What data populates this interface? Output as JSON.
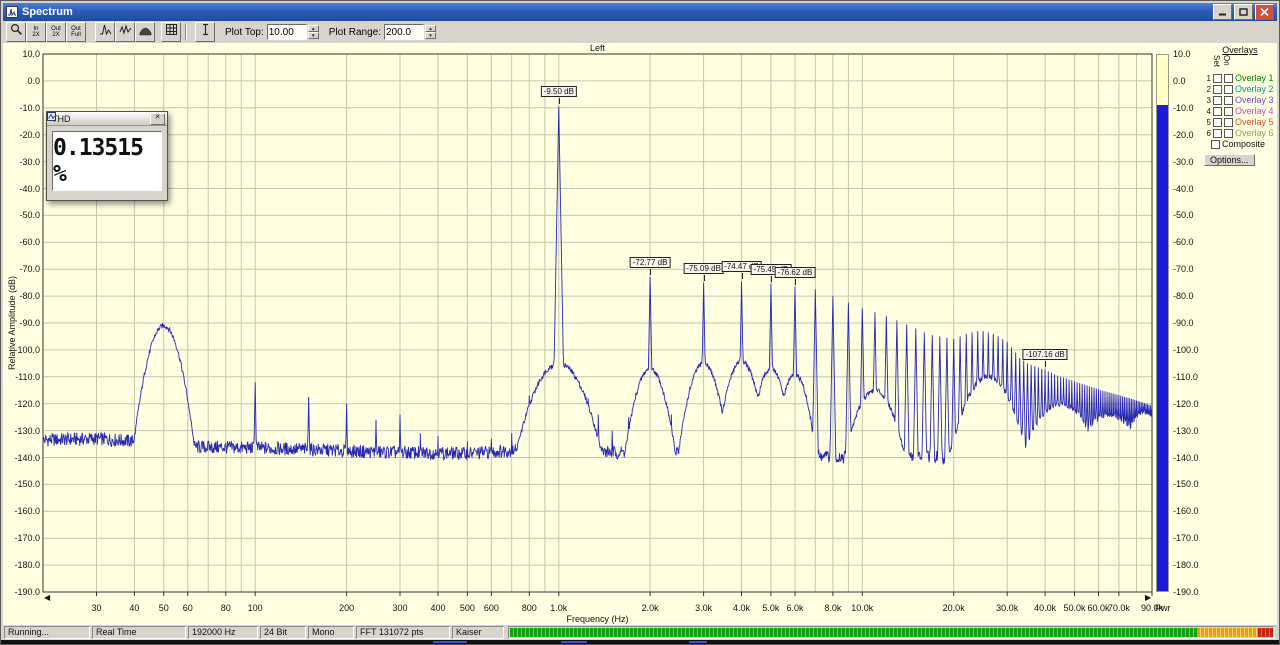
{
  "window": {
    "title": "Spectrum",
    "controls": [
      "minimize",
      "maximize",
      "close"
    ]
  },
  "toolbar": {
    "buttons": [
      {
        "name": "zoom-select-button",
        "icon": "magnifier"
      },
      {
        "name": "zoom-in-2x-button",
        "lines": [
          "In",
          "2X"
        ]
      },
      {
        "name": "zoom-out-2x-button",
        "lines": [
          "Out",
          "2X"
        ]
      },
      {
        "name": "zoom-out-full-button",
        "lines": [
          "Out",
          "Full"
        ]
      },
      {
        "name": "peak-hold-button",
        "icon": "peak-curve"
      },
      {
        "name": "line-plot-button",
        "icon": "line-curve"
      },
      {
        "name": "filled-plot-button",
        "icon": "filled-curve"
      },
      {
        "name": "data-table-button",
        "icon": "grid"
      },
      {
        "name": "marker-tool-button",
        "icon": "ibeam"
      }
    ],
    "plot_top_label": "Plot Top:",
    "plot_top_value": "10.00",
    "plot_range_label": "Plot Range:",
    "plot_range_value": "200.0"
  },
  "thd_window": {
    "title": "THD",
    "value": "0.13515 %"
  },
  "overlays": {
    "header": "Overlays",
    "col_set": "Set",
    "col_on": "On",
    "rows": [
      {
        "num": "1",
        "label": "Overlay 1",
        "color": "#008800"
      },
      {
        "num": "2",
        "label": "Overlay 2",
        "color": "#009999"
      },
      {
        "num": "3",
        "label": "Overlay 3",
        "color": "#7744cc"
      },
      {
        "num": "4",
        "label": "Overlay 4",
        "color": "#cc44cc"
      },
      {
        "num": "5",
        "label": "Overlay 5",
        "color": "#dd5522"
      },
      {
        "num": "6",
        "label": "Overlay 6",
        "color": "#aa9944"
      }
    ],
    "composite_label": "Composite",
    "options_button": "Options..."
  },
  "statusbar": {
    "items": [
      "Running...",
      "Real Time",
      "192000 Hz",
      "24 Bit",
      "Mono",
      "FFT 131072 pts",
      "Kaiser"
    ],
    "meter": {
      "green_pct": 90,
      "amber_pct": 8,
      "red_pct": 2
    }
  },
  "chart_data": {
    "type": "line",
    "title": "Left",
    "xlabel": "Frequency (Hz)",
    "ylabel": "Relative Amplitude (dB)",
    "xscale": "log",
    "xlim": [
      20,
      90000
    ],
    "ylim": [
      -190,
      10
    ],
    "ytick_step": 10,
    "grid": true,
    "trace_color": "#2828b4",
    "background_color": "#ffffe1",
    "x_ticks": [
      {
        "f": 30,
        "l": "30"
      },
      {
        "f": 40,
        "l": "40"
      },
      {
        "f": 50,
        "l": "50"
      },
      {
        "f": 60,
        "l": "60"
      },
      {
        "f": 80,
        "l": "80"
      },
      {
        "f": 100,
        "l": "100"
      },
      {
        "f": 200,
        "l": "200"
      },
      {
        "f": 300,
        "l": "300"
      },
      {
        "f": 400,
        "l": "400"
      },
      {
        "f": 500,
        "l": "500"
      },
      {
        "f": 600,
        "l": "600"
      },
      {
        "f": 800,
        "l": "800"
      },
      {
        "f": 1000,
        "l": "1.0k"
      },
      {
        "f": 2000,
        "l": "2.0k"
      },
      {
        "f": 3000,
        "l": "3.0k"
      },
      {
        "f": 4000,
        "l": "4.0k"
      },
      {
        "f": 5000,
        "l": "5.0k"
      },
      {
        "f": 6000,
        "l": "6.0k"
      },
      {
        "f": 8000,
        "l": "8.0k"
      },
      {
        "f": 10000,
        "l": "10.0k"
      },
      {
        "f": 20000,
        "l": "20.0k"
      },
      {
        "f": 30000,
        "l": "30.0k"
      },
      {
        "f": 40000,
        "l": "40.0k"
      },
      {
        "f": 50000,
        "l": "50.0k"
      },
      {
        "f": 60000,
        "l": "60.0k"
      },
      {
        "f": 70000,
        "l": "70.0k"
      },
      {
        "f": 90000,
        "l": "90.0k"
      }
    ],
    "noise_floor": [
      [
        20,
        -133.5
      ],
      [
        30,
        -133
      ],
      [
        40,
        -134
      ],
      [
        60,
        -136
      ],
      [
        100,
        -136.5
      ],
      [
        150,
        -137
      ],
      [
        250,
        -138
      ],
      [
        500,
        -138.5
      ],
      [
        800,
        -137
      ],
      [
        1500,
        -138
      ],
      [
        3000,
        -139
      ],
      [
        6000,
        -139.5
      ],
      [
        12000,
        -140
      ],
      [
        30000,
        -140
      ],
      [
        90000,
        -140.5
      ]
    ],
    "mounds": [
      [
        50,
        -91,
        0.105
      ],
      [
        1000,
        -105,
        0.145
      ],
      [
        2000,
        -107,
        0.085
      ],
      [
        3000,
        -105,
        0.085
      ],
      [
        4000,
        -104,
        0.085
      ],
      [
        5000,
        -107,
        0.075
      ],
      [
        6000,
        -109,
        0.07
      ],
      [
        11000,
        -115,
        0.1
      ],
      [
        26000,
        -110,
        0.13
      ],
      [
        45000,
        -120,
        0.13
      ],
      [
        65000,
        -124,
        0.12
      ],
      [
        85000,
        -123,
        0.08
      ]
    ],
    "peaks": [
      [
        100,
        -112
      ],
      [
        150,
        -117.5
      ],
      [
        200,
        -120
      ],
      [
        250,
        -126
      ],
      [
        300,
        -124
      ],
      [
        350,
        -131
      ],
      [
        400,
        -132
      ],
      [
        500,
        -134
      ],
      [
        600,
        -133
      ],
      [
        700,
        -131
      ],
      [
        800,
        -117
      ],
      [
        850,
        -113
      ],
      [
        900,
        -110
      ],
      [
        950,
        -107
      ],
      [
        1000,
        -9.5
      ],
      [
        1055,
        -107
      ],
      [
        1110,
        -110
      ],
      [
        1170,
        -113
      ],
      [
        1250,
        -118
      ],
      [
        1350,
        -124
      ],
      [
        1500,
        -130
      ],
      [
        1700,
        -125
      ],
      [
        1800,
        -118
      ],
      [
        1900,
        -113
      ],
      [
        2000,
        -72.77
      ],
      [
        2110,
        -112
      ],
      [
        2220,
        -117
      ],
      [
        2350,
        -124
      ],
      [
        2700,
        -121
      ],
      [
        2850,
        -114
      ],
      [
        3000,
        -75.09
      ],
      [
        3160,
        -113
      ],
      [
        3320,
        -120
      ],
      [
        3700,
        -120
      ],
      [
        3850,
        -112
      ],
      [
        4000,
        -74.47
      ],
      [
        4160,
        -112
      ],
      [
        4320,
        -119
      ],
      [
        4750,
        -116
      ],
      [
        5000,
        -75.45
      ],
      [
        5260,
        -115
      ],
      [
        5700,
        -118
      ],
      [
        6000,
        -76.62
      ],
      [
        6320,
        -117
      ],
      [
        7000,
        -77.5
      ],
      [
        8000,
        -80
      ],
      [
        9000,
        -82.5
      ],
      [
        10000,
        -84.5
      ],
      [
        11000,
        -86
      ],
      [
        12000,
        -87.5
      ],
      [
        13000,
        -89
      ],
      [
        14000,
        -90.5
      ],
      [
        15000,
        -92
      ],
      [
        16000,
        -93.5
      ],
      [
        17000,
        -94.5
      ],
      [
        18000,
        -95
      ],
      [
        19000,
        -95.5
      ],
      [
        20000,
        -96
      ],
      [
        21000,
        -95
      ],
      [
        22000,
        -94
      ],
      [
        23000,
        -93.5
      ],
      [
        24000,
        -93
      ],
      [
        25000,
        -93
      ],
      [
        26000,
        -93.5
      ],
      [
        27000,
        -94
      ],
      [
        28000,
        -95
      ],
      [
        29000,
        -96
      ],
      [
        30000,
        -97
      ],
      [
        31000,
        -99
      ],
      [
        32000,
        -101
      ],
      [
        33000,
        -103
      ],
      [
        34000,
        -104
      ],
      [
        35000,
        -105
      ],
      [
        36000,
        -105.5
      ],
      [
        37000,
        -106
      ],
      [
        38000,
        -106.5
      ],
      [
        39000,
        -107
      ],
      [
        40000,
        -107.16
      ],
      [
        41000,
        -108
      ],
      [
        42000,
        -108.5
      ],
      [
        43000,
        -109
      ],
      [
        44000,
        -109.5
      ],
      [
        45000,
        -110
      ],
      [
        46000,
        -110.3
      ],
      [
        47000,
        -110.6
      ],
      [
        48000,
        -111
      ],
      [
        49000,
        -111.3
      ],
      [
        50000,
        -111.6
      ],
      [
        51000,
        -112
      ],
      [
        52000,
        -112.3
      ],
      [
        53000,
        -112.6
      ],
      [
        54000,
        -112.9
      ],
      [
        55000,
        -113.2
      ],
      [
        56000,
        -113.5
      ],
      [
        57000,
        -113.8
      ],
      [
        58000,
        -114.1
      ],
      [
        59000,
        -114.4
      ],
      [
        60000,
        -114.7
      ],
      [
        61000,
        -115
      ],
      [
        62000,
        -115.2
      ],
      [
        63000,
        -115.4
      ],
      [
        64000,
        -115.6
      ],
      [
        65000,
        -115.8
      ],
      [
        66000,
        -116
      ],
      [
        67000,
        -116.2
      ],
      [
        68000,
        -116.4
      ],
      [
        69000,
        -116.6
      ],
      [
        70000,
        -116.8
      ],
      [
        71000,
        -117
      ],
      [
        72000,
        -117.2
      ],
      [
        73000,
        -117.4
      ],
      [
        74000,
        -117.6
      ],
      [
        75000,
        -117.8
      ],
      [
        76000,
        -118
      ],
      [
        77000,
        -118.2
      ],
      [
        78000,
        -118.4
      ],
      [
        79000,
        -118.6
      ],
      [
        80000,
        -118.8
      ],
      [
        81000,
        -119
      ],
      [
        82000,
        -119.2
      ],
      [
        83000,
        -119.4
      ],
      [
        84000,
        -119.6
      ],
      [
        85000,
        -119.8
      ],
      [
        86000,
        -120
      ],
      [
        87000,
        -120.2
      ],
      [
        88000,
        -120.4
      ],
      [
        89000,
        -120.6
      ],
      [
        90000,
        -120.8
      ]
    ],
    "peak_labels": [
      {
        "text": "-9.50 dB",
        "f": 1000,
        "db": -9.5
      },
      {
        "text": "-72.77 dB",
        "f": 2000,
        "db": -72.77
      },
      {
        "text": "-75.09 dB",
        "f": 3000,
        "db": -75.09
      },
      {
        "text": "-74.47 dB",
        "f": 4000,
        "db": -74.47
      },
      {
        "text": "-75.45 dB",
        "f": 5000,
        "db": -75.45
      },
      {
        "text": "-76.62 dB",
        "f": 6000,
        "db": -76.62
      },
      {
        "text": "-107.16 dB",
        "f": 40000,
        "db": -107.16
      }
    ],
    "pwr_bar": {
      "label": "Pwr",
      "level_db": -9.5,
      "fill_color": "#1a1ad8",
      "bg_color": "#ffffc6"
    }
  }
}
